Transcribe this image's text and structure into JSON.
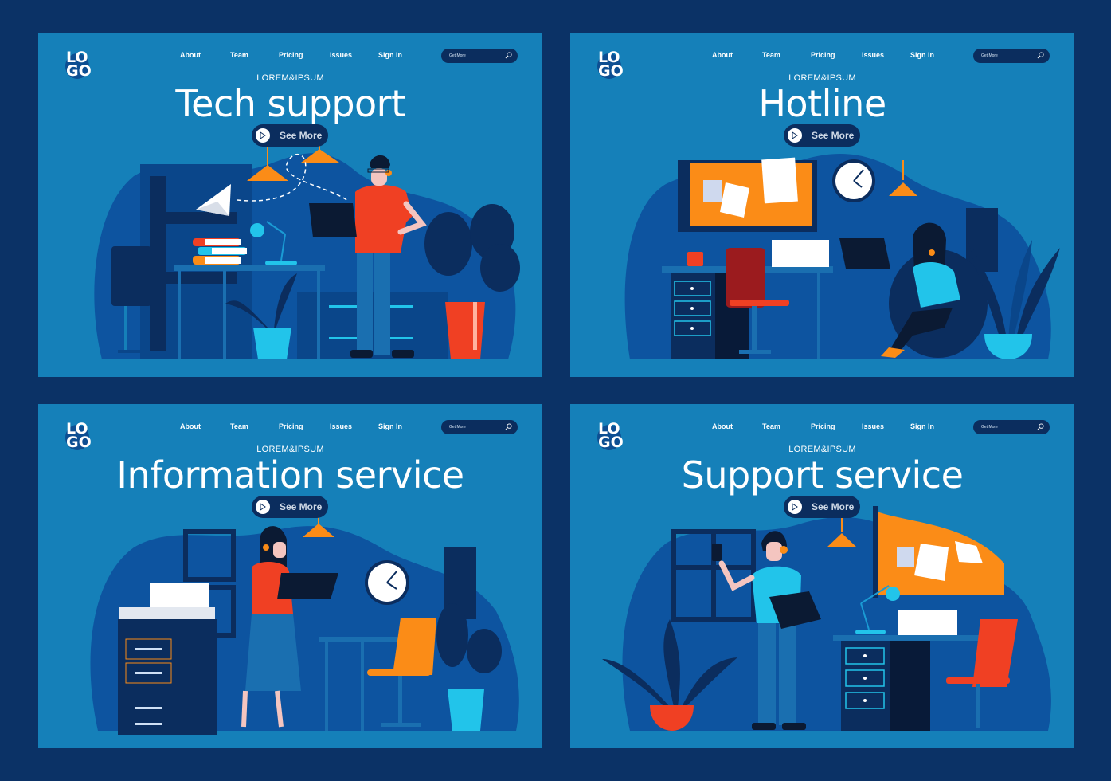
{
  "colors": {
    "page_background": "#0b3266",
    "panel_background": "#1580b9",
    "scene_blob": "#0d54a0",
    "dark_navy": "#0b2d5e",
    "accent_orange": "#fb8c17",
    "accent_red": "#f04023",
    "accent_cyan": "#22c4ea"
  },
  "panels": [
    {
      "logo": "LO GO",
      "logo_line1": "LO",
      "logo_line2": "GO",
      "nav": [
        "About",
        "Team",
        "Pricing",
        "Issues",
        "Sign In"
      ],
      "search": {
        "placeholder": "Get More",
        "icon": "search-icon"
      },
      "overline": "LOREM&IPSUM",
      "title": "Tech support",
      "cta": {
        "label": "See More",
        "icon": "play-icon"
      },
      "illustration": "man-with-headset-holding-laptop-in-office"
    },
    {
      "logo": "LO GO",
      "logo_line1": "LO",
      "logo_line2": "GO",
      "nav": [
        "About",
        "Team",
        "Pricing",
        "Issues",
        "Sign In"
      ],
      "search": {
        "placeholder": "Get More",
        "icon": "search-icon"
      },
      "overline": "LOREM&IPSUM",
      "title": "Hotline",
      "cta": {
        "label": "See More",
        "icon": "play-icon"
      },
      "illustration": "woman-with-headset-on-beanbag-with-laptop"
    },
    {
      "logo": "LO GO",
      "logo_line1": "LO",
      "logo_line2": "GO",
      "nav": [
        "About",
        "Team",
        "Pricing",
        "Issues",
        "Sign In"
      ],
      "search": {
        "placeholder": "Get More",
        "icon": "search-icon"
      },
      "overline": "LOREM&IPSUM",
      "title": "Information service",
      "cta": {
        "label": "See More",
        "icon": "play-icon"
      },
      "illustration": "woman-with-headset-carrying-laptop-near-printer"
    },
    {
      "logo": "LO GO",
      "logo_line1": "LO",
      "logo_line2": "GO",
      "nav": [
        "About",
        "Team",
        "Pricing",
        "Issues",
        "Sign In"
      ],
      "search": {
        "placeholder": "Get More",
        "icon": "search-icon"
      },
      "overline": "LOREM&IPSUM",
      "title": "Support service",
      "cta": {
        "label": "See More",
        "icon": "play-icon"
      },
      "illustration": "man-with-headset-holding-phone-and-folder"
    }
  ]
}
